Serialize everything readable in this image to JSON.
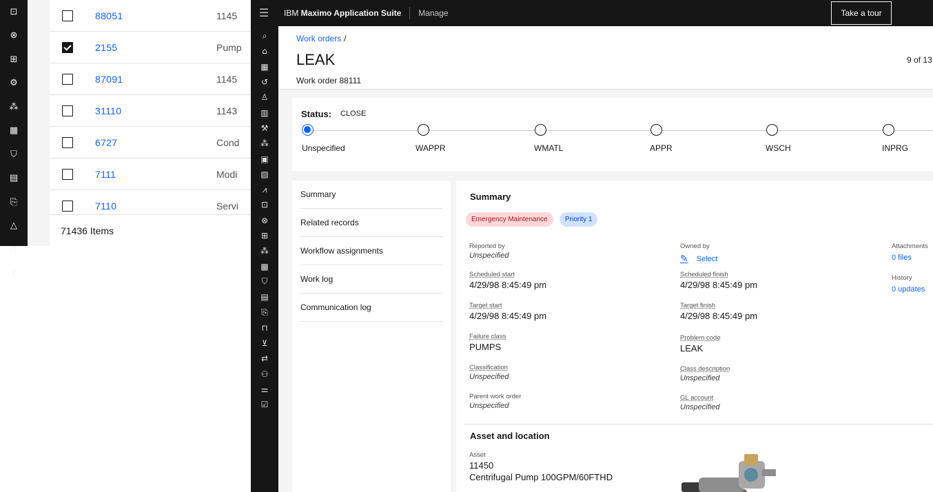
{
  "background_list": {
    "rows": [
      {
        "number": "88051",
        "desc": "1145",
        "checked": false
      },
      {
        "number": "2155",
        "desc": "Pump",
        "checked": true
      },
      {
        "number": "87091",
        "desc": "1145",
        "checked": false
      },
      {
        "number": "31110",
        "desc": "1143",
        "checked": false
      },
      {
        "number": "6727",
        "desc": "Cond",
        "checked": false
      },
      {
        "number": "7111",
        "desc": "Modi",
        "checked": false
      },
      {
        "number": "7110",
        "desc": "Servi",
        "checked": false
      }
    ],
    "footer": "71436 Items"
  },
  "topbar": {
    "brand_prefix": "IBM ",
    "brand_name": "Maximo Application Suite",
    "product": "Manage",
    "tour_button": "Take a tour"
  },
  "header": {
    "breadcrumb": "Work orders",
    "breadcrumb_sep": "/",
    "title": "LEAK",
    "subtitle": "Work order 88111",
    "pager": "9 of 13"
  },
  "status": {
    "label": "Status:",
    "value": "CLOSE",
    "steps": [
      "Unspecified",
      "WAPPR",
      "WMATL",
      "APPR",
      "WSCH",
      "INPRG"
    ],
    "active_index": 0
  },
  "tabs": [
    "Summary",
    "Related records",
    "Workflow assignments",
    "Work log",
    "Communication log"
  ],
  "summary": {
    "title": "Summary",
    "tags": [
      "Emergency Maintenance",
      "Priority 1"
    ],
    "fields": {
      "reported_by": {
        "label": "Reported by",
        "value": "Unspecified"
      },
      "owned_by": {
        "label": "Owned by",
        "value": "Select"
      },
      "attachments": {
        "label": "Attachments",
        "value": "0 files"
      },
      "scheduled_start": {
        "label": "Scheduled start",
        "value": "4/29/98 8:45:49 pm"
      },
      "scheduled_finish": {
        "label": "Scheduled finish",
        "value": "4/29/98 8:45:49 pm"
      },
      "history": {
        "label": "History",
        "value": "0 updates"
      },
      "target_start": {
        "label": "Target start",
        "value": "4/29/98 8:45:49 pm"
      },
      "target_finish": {
        "label": "Target finish",
        "value": "4/29/98 8:45:49 pm"
      },
      "failure_class": {
        "label": "Failure class",
        "value": "PUMPS"
      },
      "problem_code": {
        "label": "Problem code",
        "value": "LEAK"
      },
      "classification": {
        "label": "Classification",
        "value": "Unspecified"
      },
      "class_description": {
        "label": "Class description",
        "value": "Unspecified"
      },
      "parent_work_order": {
        "label": "Parent work order",
        "value": "Unspecified"
      },
      "gl_account": {
        "label": "GL account",
        "value": "Unspecified"
      }
    }
  },
  "asset": {
    "title": "Asset and location",
    "label": "Asset",
    "id": "11450",
    "description": "Centrifugal Pump 100GPM/60FTHD"
  },
  "colors": {
    "accent": "#0f62fe",
    "shell": "#161616",
    "tag_red_bg": "#ffd7d9",
    "tag_blue_bg": "#d0e2ff"
  },
  "icons": {
    "bg_rail": [
      "report-icon",
      "network-icon",
      "briefcase-icon",
      "settings-icon",
      "flow-icon",
      "calendar-icon",
      "shield-icon",
      "receipt-icon",
      "clipboard-icon",
      "warning-icon",
      "lock-icon",
      "cart-icon"
    ],
    "side_rail": [
      "search-icon",
      "home-icon",
      "table-icon",
      "history-icon",
      "user-icon",
      "chart-icon",
      "tool-icon",
      "flow-icon",
      "document-icon",
      "file-icon",
      "analytics-icon",
      "report-icon",
      "network-icon",
      "briefcase-icon",
      "flow-icon",
      "calendar-icon",
      "shield-icon",
      "receipt-icon",
      "clipboard-icon",
      "lock-icon",
      "cart-icon",
      "transfer-icon",
      "people-icon",
      "sliders-icon",
      "checklist-icon"
    ]
  }
}
